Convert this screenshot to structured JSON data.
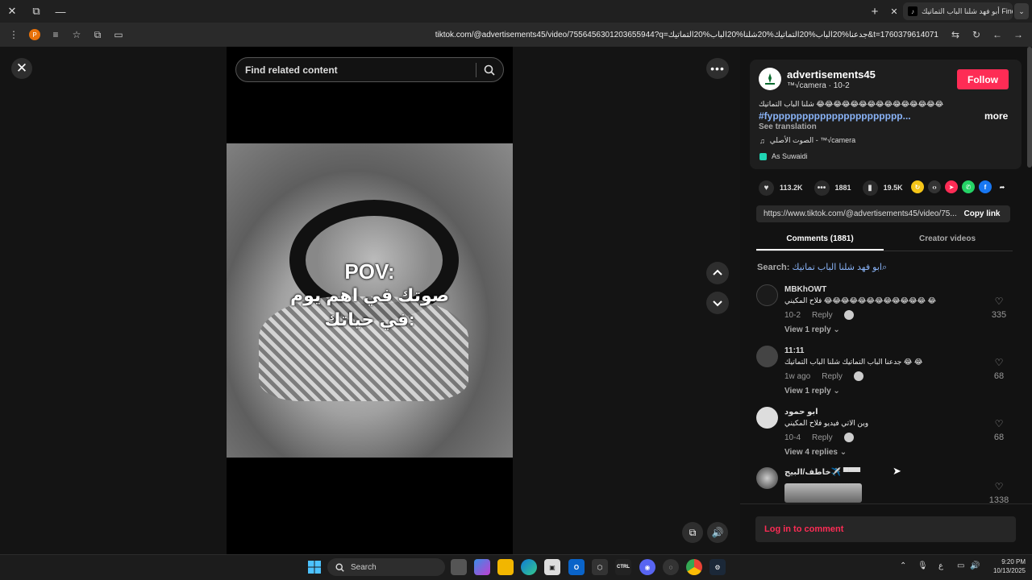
{
  "browser": {
    "tab_title": "أبو فهد شلنا الباب التماتيك Find\"",
    "url": "tiktok.com/@advertisements45/video/7556456301203655944?q=جدعنا%20الباب%20التماتيك%20شلنا%20الباب%20التماتيك&t=1760379614071",
    "profile_initial": "P"
  },
  "player": {
    "search_placeholder": "Find related content",
    "overlay_line1": "POV:",
    "overlay_line2": "صوتك في اهم يوم",
    "overlay_line3": "في حياتك:"
  },
  "video": {
    "username": "advertisements45",
    "subtitle": "™√camera · 10-2",
    "follow_label": "Follow",
    "description": "شلنا الباب التماتيك 😂😂😂😂😂😂😂😂😂😂😂😂😂😂😂",
    "hashtag": "#fypppppppppppppppppppppp...",
    "more_label": "more",
    "see_translation": "See translation",
    "music": "الصوت الأصلي - ™√camera",
    "effect": "As Suwaidi",
    "likes": "113.2K",
    "comments": "1881",
    "saves": "19.5K",
    "share_url": "https://www.tiktok.com/@advertisements45/video/75...",
    "copy_link": "Copy link"
  },
  "tabs": {
    "comments": "Comments (1881)",
    "creator_videos": "Creator videos"
  },
  "search_hint": {
    "label": "Search:",
    "query": "ابو فهد شلنا الباب تماتيك"
  },
  "comments": [
    {
      "name": "MBKhOWT",
      "text": "فلاح المكيني 😂😂😂😂😂😂😂😂😂😂😂😂 😂",
      "date": "10-2",
      "reply": "Reply",
      "replies": "View 1 reply",
      "likes": "335"
    },
    {
      "name": "11:11",
      "text": "جدعنا الباب التماتيك شلنا الباب التماتيك 😂 😂",
      "date": "1w ago",
      "reply": "Reply",
      "replies": "View 1 reply",
      "likes": "68"
    },
    {
      "name": "ابو حمود",
      "text": "وين الاتي فيديو فلاح المكيني",
      "date": "10-4",
      "reply": "Reply",
      "replies": "View 4 replies",
      "likes": "68"
    },
    {
      "name": "خاطف/البيج✈️ ▀▀▀",
      "text": "",
      "date": "",
      "reply": "",
      "replies": "",
      "likes": "1338"
    }
  ],
  "login_label": "Log in to comment",
  "taskbar": {
    "search_label": "Search",
    "time": "9:20 PM",
    "date": "10/13/2025",
    "lang": "ع"
  },
  "colors": {
    "accent": "#fe2c55",
    "link": "#8ab4f8"
  }
}
